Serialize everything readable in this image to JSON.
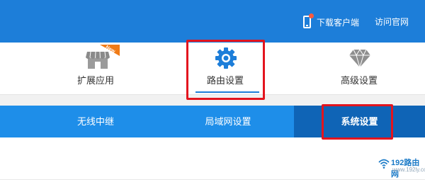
{
  "header": {
    "download_label": "下载客户端",
    "site_label": "访问官网",
    "accent_color": "#1d7ed9"
  },
  "features": [
    {
      "label": "扩展应用",
      "icon": "store-icon",
      "badge": "New"
    },
    {
      "label": "路由设置",
      "icon": "gear-icon",
      "active": true
    },
    {
      "label": "高级设置",
      "icon": "diamond-icon"
    }
  ],
  "tabs": [
    {
      "label": "无线中继"
    },
    {
      "label": "局域网设置"
    },
    {
      "label": "系统设置",
      "active": true
    }
  ],
  "highlight_color": "#e3141e",
  "watermark": {
    "brand": "192路由网",
    "url": "www.192ly.com"
  }
}
